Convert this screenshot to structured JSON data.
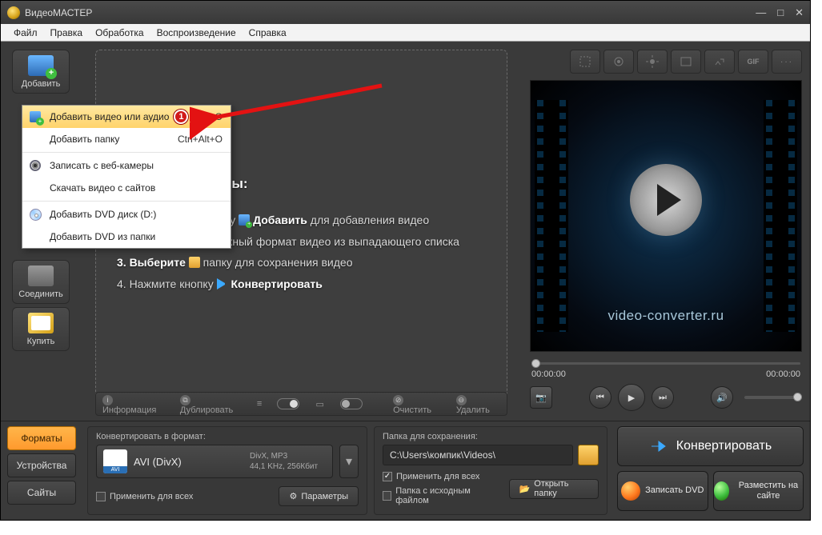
{
  "title": "ВидеоМАСТЕР",
  "menus": [
    "Файл",
    "Правка",
    "Обработка",
    "Воспроизведение",
    "Справка"
  ],
  "sidebar": {
    "add": "Добавить",
    "join": "Соединить",
    "buy": "Купить"
  },
  "dropdown": {
    "add_video": "Добавить видео или аудио",
    "add_video_sc": "trl+O",
    "add_folder": "Добавить папку",
    "add_folder_sc": "Ctrl+Alt+O",
    "rec_webcam": "Записать с веб-камеры",
    "download_site": "Скачать видео с сайтов",
    "add_dvd_disk": "Добавить DVD диск (D:)",
    "add_dvd_folder": "Добавить DVD из папки",
    "badge1": "1"
  },
  "steps": {
    "hd_suffix": "ты:",
    "s1a": "ку",
    "s1b": "Добавить",
    "s1c": "для добавления видео",
    "s2a": "жный формат видео из выпадающего списка",
    "s3": "3. Выберите",
    "s3b": "папку для сохранения видео",
    "s4": "4. Нажмите кнопку",
    "s4b": "Конвертировать"
  },
  "toolbar": {
    "info": "Информация",
    "dup": "Дублировать",
    "clear": "Очистить",
    "del": "Удалить"
  },
  "preview": {
    "watermark": "video-converter.ru",
    "t0": "00:00:00",
    "t1": "00:00:00"
  },
  "bottom": {
    "tabs": [
      "Форматы",
      "Устройства",
      "Сайты"
    ],
    "conv_lbl": "Конвертировать в формат:",
    "fmt_name": "AVI (DivX)",
    "fmt_det1": "DivX, MP3",
    "fmt_det2": "44,1 KHz, 256Кбит",
    "apply_all": "Применить для всех",
    "params": "Параметры",
    "save_lbl": "Папка для сохранения:",
    "path": "C:\\Users\\компик\\Videos\\",
    "save_apply": "Применить для всех",
    "save_src": "Папка с исходным файлом",
    "open_folder": "Открыть папку",
    "convert": "Конвертировать",
    "rec_dvd": "Записать DVD",
    "publish": "Разместить на сайте"
  }
}
